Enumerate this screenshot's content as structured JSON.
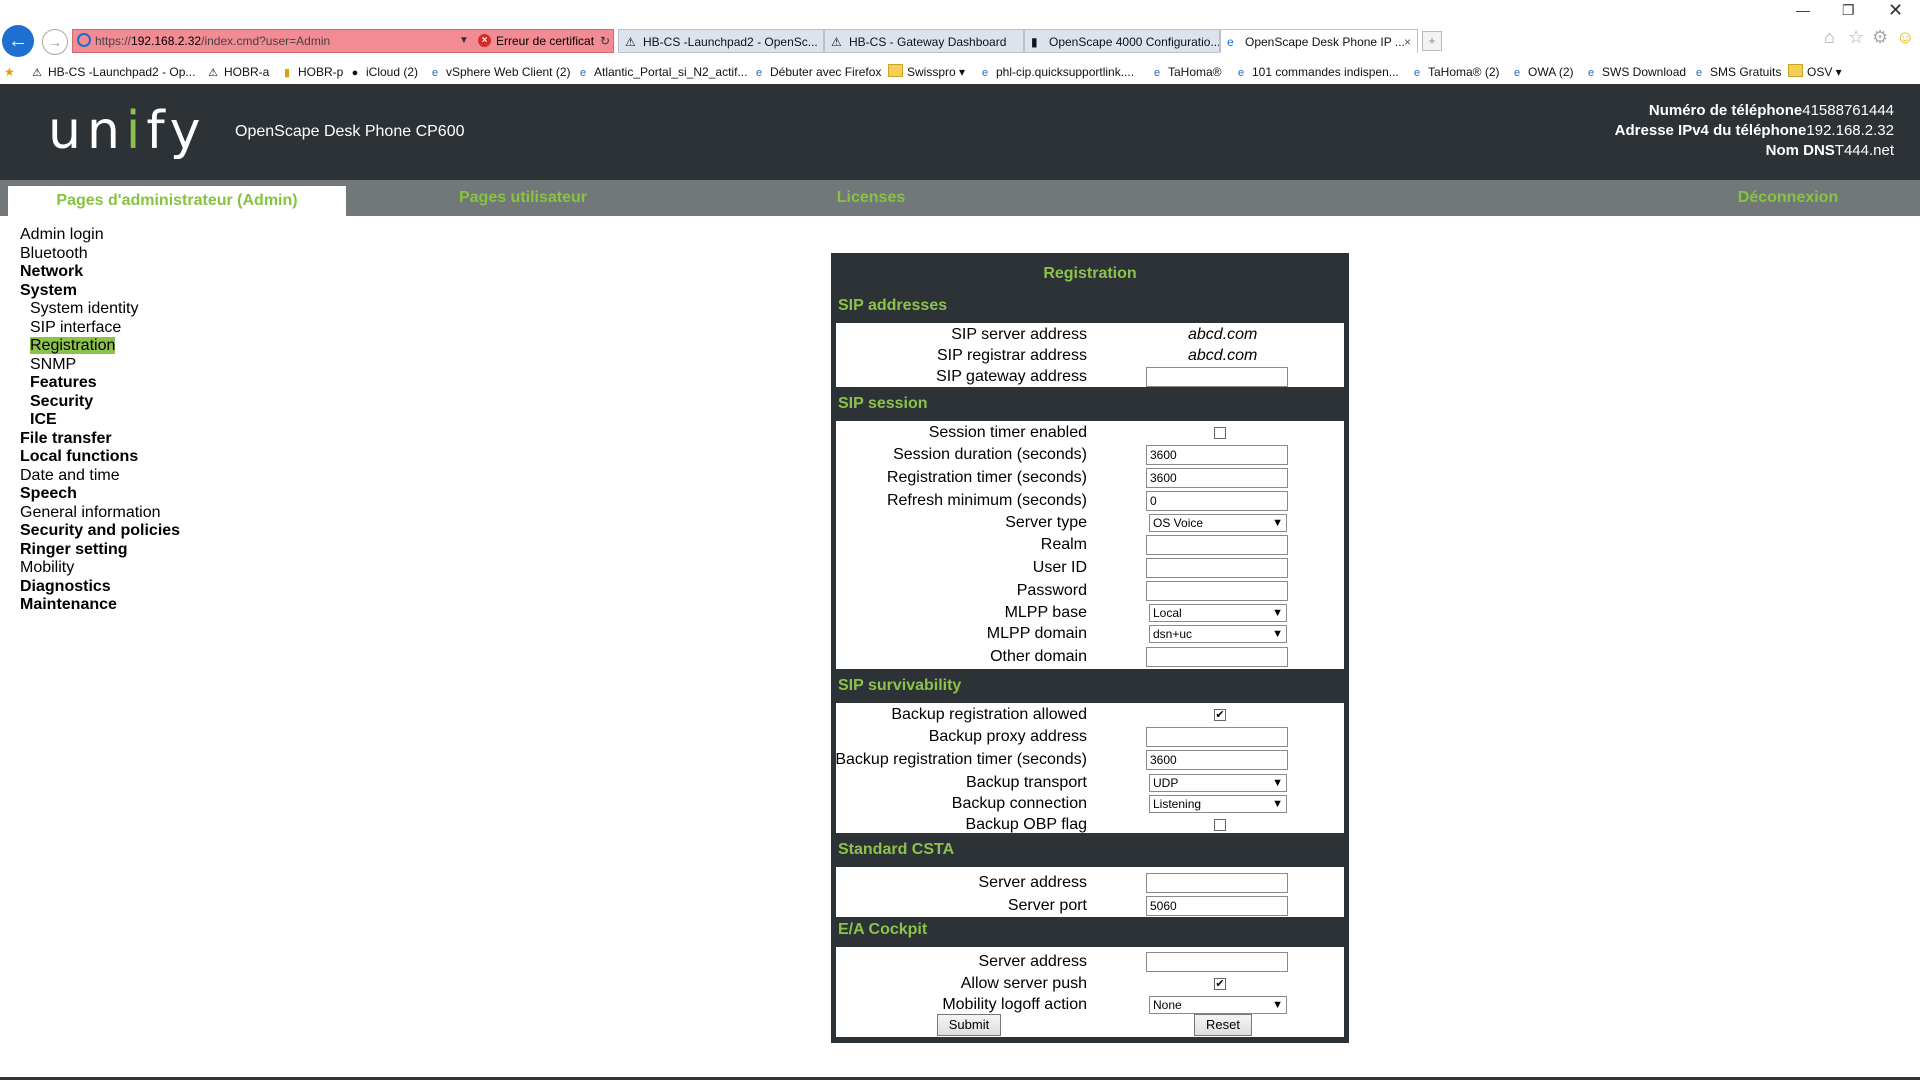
{
  "browser": {
    "address": {
      "scheme": "https://",
      "host": "192.168.2.32",
      "path": "/index.cmd?user=Admin",
      "cert_error": "Erreur de certificat"
    },
    "tabs": [
      {
        "label": "HB-CS -Launchpad2 - OpenSc...",
        "icon": "warning-icon",
        "active": false
      },
      {
        "label": "HB-CS - Gateway Dashboard",
        "icon": "warning-icon",
        "active": false
      },
      {
        "label": "OpenScape 4000 Configuratio...",
        "icon": "page-icon",
        "active": false
      },
      {
        "label": "OpenScape Desk Phone IP ...",
        "icon": "ie-icon",
        "active": true
      }
    ],
    "favorites": [
      "HB-CS -Launchpad2 - Op...",
      "HOBR-a",
      "HOBR-p",
      "iCloud (2)",
      "vSphere Web Client (2)",
      "Atlantic_Portal_si_N2_actif...",
      "Débuter avec Firefox",
      "Swisspro ▾",
      "phl-cip.quicksupportlink....",
      "TaHoma®",
      "101 commandes indispen...",
      "TaHoma® (2)",
      "OWA (2)",
      "SWS Download",
      "SMS Gratuits",
      "OSV ▾"
    ]
  },
  "header": {
    "logo": "unify",
    "product": "OpenScape Desk Phone CP600",
    "phone_number_label": "Numéro de téléphone",
    "phone_number": "41588761444",
    "ipv4_label": "Adresse IPv4 du téléphone",
    "ipv4": "192.168.2.32",
    "dns_label": "Nom DNS",
    "dns": "T444.net"
  },
  "nav": {
    "admin": "Pages d'administrateur (Admin)",
    "user": "Pages utilisateur",
    "licenses": "Licenses",
    "logout": "Déconnexion"
  },
  "sidebar": [
    "Admin login",
    "Bluetooth",
    "Network",
    "System",
    "System identity",
    "SIP interface",
    "Registration",
    "SNMP",
    "Features",
    "Security",
    "ICE",
    "File transfer",
    "Local functions",
    "Date and time",
    "Speech",
    "General information",
    "Security and policies",
    "Ringer setting",
    "Mobility",
    "Diagnostics",
    "Maintenance"
  ],
  "form": {
    "title": "Registration",
    "sections": {
      "sip_addresses": "SIP addresses",
      "sip_session": "SIP session",
      "sip_survivability": "SIP survivability",
      "standard_csta": "Standard CSTA",
      "ea_cockpit": "E/A Cockpit"
    },
    "fields": {
      "sip_server_address": {
        "label": "SIP server address",
        "value": "abcd.com"
      },
      "sip_registrar_address": {
        "label": "SIP registrar address",
        "value": "abcd.com"
      },
      "sip_gateway_address": {
        "label": "SIP gateway address",
        "value": ""
      },
      "session_timer_enabled": {
        "label": "Session timer enabled",
        "checked": false
      },
      "session_duration": {
        "label": "Session duration (seconds)",
        "value": "3600"
      },
      "registration_timer": {
        "label": "Registration timer (seconds)",
        "value": "3600"
      },
      "refresh_minimum": {
        "label": "Refresh minimum (seconds)",
        "value": "0"
      },
      "server_type": {
        "label": "Server type",
        "value": "OS Voice"
      },
      "realm": {
        "label": "Realm",
        "value": ""
      },
      "user_id": {
        "label": "User ID",
        "value": ""
      },
      "password": {
        "label": "Password",
        "value": ""
      },
      "mlpp_base": {
        "label": "MLPP base",
        "value": "Local"
      },
      "mlpp_domain": {
        "label": "MLPP domain",
        "value": "dsn+uc"
      },
      "other_domain": {
        "label": "Other domain",
        "value": ""
      },
      "backup_registration_allowed": {
        "label": "Backup registration allowed",
        "checked": true
      },
      "backup_proxy_address": {
        "label": "Backup proxy address",
        "value": ""
      },
      "backup_registration_timer": {
        "label": "Backup registration timer (seconds)",
        "value": "3600"
      },
      "backup_transport": {
        "label": "Backup transport",
        "value": "UDP"
      },
      "backup_connection": {
        "label": "Backup connection",
        "value": "Listening"
      },
      "backup_obp_flag": {
        "label": "Backup OBP flag",
        "checked": false
      },
      "csta_server_address": {
        "label": "Server address",
        "value": ""
      },
      "csta_server_port": {
        "label": "Server port",
        "value": "5060"
      },
      "ea_server_address": {
        "label": "Server address",
        "value": ""
      },
      "allow_server_push": {
        "label": "Allow server push",
        "checked": true
      },
      "mobility_logoff_action": {
        "label": "Mobility logoff action",
        "value": "None"
      }
    },
    "submit": "Submit",
    "reset": "Reset"
  },
  "colors": {
    "accent_green": "#8bc34a",
    "header_dark": "#2d3236",
    "nav_gray": "#727779",
    "address_error": "#f28b93"
  }
}
